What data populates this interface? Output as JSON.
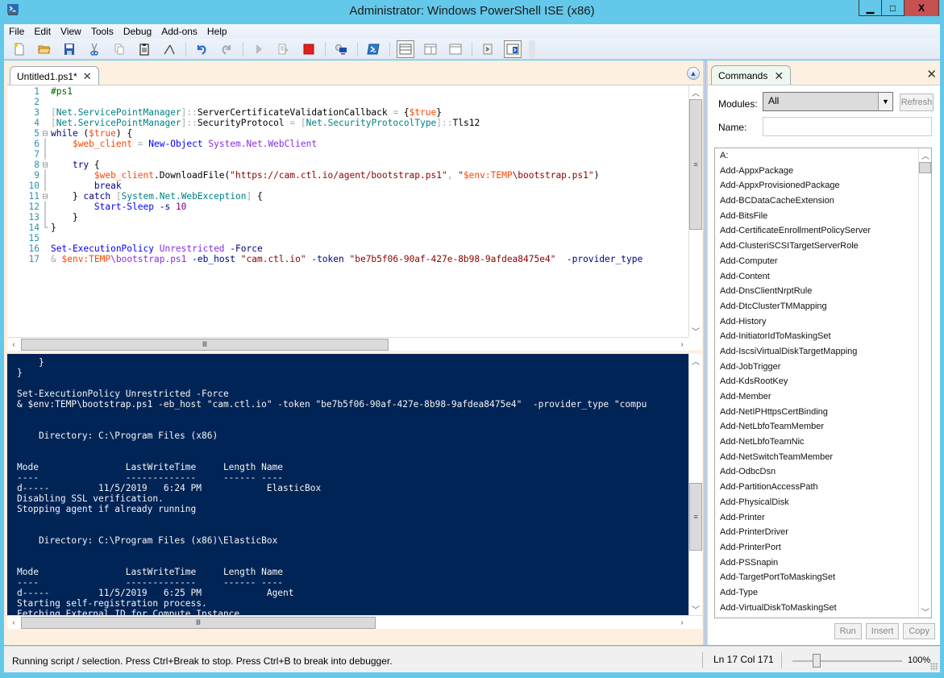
{
  "window": {
    "title": "Administrator: Windows PowerShell ISE (x86)",
    "controls": {
      "minimize": "▁",
      "maximize": "□",
      "close": "X"
    }
  },
  "menu": [
    "File",
    "Edit",
    "View",
    "Tools",
    "Debug",
    "Add-ons",
    "Help"
  ],
  "toolbar": {
    "buttons": [
      {
        "name": "new-icon",
        "tooltip": "New"
      },
      {
        "name": "open-icon",
        "tooltip": "Open"
      },
      {
        "name": "save-icon",
        "tooltip": "Save"
      },
      {
        "name": "cut-icon",
        "tooltip": "Cut"
      },
      {
        "name": "copy-icon",
        "tooltip": "Copy"
      },
      {
        "name": "paste-icon",
        "tooltip": "Paste"
      },
      {
        "name": "clear-console-icon",
        "tooltip": "Clear Console Pane"
      },
      {
        "name": "undo-icon",
        "tooltip": "Undo"
      },
      {
        "name": "redo-icon",
        "tooltip": "Redo"
      },
      {
        "name": "run-icon",
        "tooltip": "Run Script"
      },
      {
        "name": "run-selection-icon",
        "tooltip": "Run Selection"
      },
      {
        "name": "stop-icon",
        "tooltip": "Stop Operation"
      },
      {
        "name": "remote-tab-icon",
        "tooltip": "New Remote PowerShell Tab"
      },
      {
        "name": "powershell-console-icon",
        "tooltip": "Start PowerShell.exe"
      },
      {
        "name": "script-top-icon",
        "tooltip": "Show Script Pane Top"
      },
      {
        "name": "script-right-icon",
        "tooltip": "Show Script Pane Right"
      },
      {
        "name": "script-max-icon",
        "tooltip": "Show Script Pane Maximized"
      },
      {
        "name": "show-addon-icon",
        "tooltip": "Show Command Window"
      },
      {
        "name": "show-command-addon-icon",
        "tooltip": "Show Command Add-on"
      }
    ]
  },
  "script_tab": {
    "label": "Untitled1.ps1*",
    "close": "✕"
  },
  "editor": {
    "lines": [
      {
        "n": "1",
        "fold": "",
        "tokens": [
          [
            "c-comment",
            "#ps1"
          ]
        ]
      },
      {
        "n": "2",
        "fold": "",
        "tokens": []
      },
      {
        "n": "3",
        "fold": "",
        "tokens": [
          [
            "c-op",
            "["
          ],
          [
            "c-type",
            "Net.ServicePointManager"
          ],
          [
            "c-op",
            "]::"
          ],
          [
            "c-mem",
            "ServerCertificateValidationCallback"
          ],
          [
            "c-op",
            " = "
          ],
          [
            "c-mem",
            "{"
          ],
          [
            "c-var",
            "$true"
          ],
          [
            "c-mem",
            "}"
          ]
        ]
      },
      {
        "n": "4",
        "fold": "",
        "tokens": [
          [
            "c-op",
            "["
          ],
          [
            "c-type",
            "Net.ServicePointManager"
          ],
          [
            "c-op",
            "]::"
          ],
          [
            "c-mem",
            "SecurityProtocol"
          ],
          [
            "c-op",
            " = "
          ],
          [
            "c-op",
            "["
          ],
          [
            "c-type",
            "Net.SecurityProtocolType"
          ],
          [
            "c-op",
            "]::"
          ],
          [
            "c-mem",
            "Tls12"
          ]
        ]
      },
      {
        "n": "5",
        "fold": "⊟",
        "tokens": [
          [
            "c-kw",
            "while"
          ],
          [
            "c-mem",
            " ("
          ],
          [
            "c-var",
            "$true"
          ],
          [
            "c-mem",
            ") {"
          ]
        ]
      },
      {
        "n": "6",
        "fold": "│",
        "tokens": [
          [
            "c-mem",
            "    "
          ],
          [
            "c-var",
            "$web_client"
          ],
          [
            "c-op",
            " = "
          ],
          [
            "c-cmd",
            "New-Object"
          ],
          [
            "c-arg",
            " System.Net.WebClient"
          ]
        ]
      },
      {
        "n": "7",
        "fold": "│",
        "tokens": []
      },
      {
        "n": "8",
        "fold": "⊟",
        "tokens": [
          [
            "c-mem",
            "    "
          ],
          [
            "c-kw",
            "try"
          ],
          [
            "c-mem",
            " {"
          ]
        ]
      },
      {
        "n": "9",
        "fold": "│",
        "tokens": [
          [
            "c-mem",
            "        "
          ],
          [
            "c-var",
            "$web_client"
          ],
          [
            "c-mem",
            ".DownloadFile("
          ],
          [
            "c-str",
            "\"https://cam.ctl.io/agent/bootstrap.ps1\""
          ],
          [
            "c-op",
            ", "
          ],
          [
            "c-str",
            "\""
          ],
          [
            "c-var",
            "$env:TEMP"
          ],
          [
            "c-str",
            "\\bootstrap.ps1\""
          ],
          [
            "c-mem",
            ")"
          ]
        ]
      },
      {
        "n": "10",
        "fold": "│",
        "tokens": [
          [
            "c-mem",
            "        "
          ],
          [
            "c-kw",
            "break"
          ]
        ]
      },
      {
        "n": "11",
        "fold": "⊟",
        "tokens": [
          [
            "c-mem",
            "    } "
          ],
          [
            "c-kw",
            "catch"
          ],
          [
            "c-mem",
            " "
          ],
          [
            "c-op",
            "["
          ],
          [
            "c-type",
            "System.Net.WebException"
          ],
          [
            "c-op",
            "]"
          ],
          [
            "c-mem",
            " {"
          ]
        ]
      },
      {
        "n": "12",
        "fold": "│",
        "tokens": [
          [
            "c-mem",
            "        "
          ],
          [
            "c-cmd",
            "Start-Sleep"
          ],
          [
            "c-param",
            " -s"
          ],
          [
            "c-num",
            " 10"
          ]
        ]
      },
      {
        "n": "13",
        "fold": "│",
        "tokens": [
          [
            "c-mem",
            "    }"
          ]
        ]
      },
      {
        "n": "14",
        "fold": "└",
        "tokens": [
          [
            "c-mem",
            "}"
          ]
        ]
      },
      {
        "n": "15",
        "fold": "",
        "tokens": []
      },
      {
        "n": "16",
        "fold": "",
        "tokens": [
          [
            "c-cmd",
            "Set-ExecutionPolicy"
          ],
          [
            "c-arg",
            " Unrestricted"
          ],
          [
            "c-param",
            " -Force"
          ]
        ]
      },
      {
        "n": "17",
        "fold": "",
        "tokens": [
          [
            "c-op",
            "& "
          ],
          [
            "c-var",
            "$env:TEMP"
          ],
          [
            "c-arg",
            "\\bootstrap.ps1"
          ],
          [
            "c-param",
            " -eb_host"
          ],
          [
            "c-str",
            " \"cam.ctl.io\""
          ],
          [
            "c-param",
            " -token"
          ],
          [
            "c-str",
            " \"be7b5f06-90af-427e-8b98-9afdea8475e4\""
          ],
          [
            "c-param",
            "  -provider_type"
          ]
        ]
      }
    ]
  },
  "console": {
    "lines": [
      "    }",
      "}",
      "",
      "Set-ExecutionPolicy Unrestricted -Force",
      "& $env:TEMP\\bootstrap.ps1 -eb_host \"cam.ctl.io\" -token \"be7b5f06-90af-427e-8b98-9afdea8475e4\"  -provider_type \"compu",
      "",
      "",
      "    Directory: C:\\Program Files (x86)",
      "",
      "",
      "Mode                LastWriteTime     Length Name",
      "----                -------------     ------ ----",
      "d-----         11/5/2019   6:24 PM            ElasticBox",
      "Disabling SSL verification.",
      "Stopping agent if already running",
      "",
      "",
      "    Directory: C:\\Program Files (x86)\\ElasticBox",
      "",
      "",
      "Mode                LastWriteTime     Length Name",
      "----                -------------     ------ ----",
      "d-----         11/5/2019   6:25 PM            Agent",
      "Starting self-registration process.",
      "Fetching External ID for Compute Instance."
    ]
  },
  "commands": {
    "tab_label": "Commands",
    "tab_close": "✕",
    "pane_close": "✕",
    "modules_label": "Modules:",
    "modules_value": "All",
    "refresh_label": "Refresh",
    "name_label": "Name:",
    "name_value": "",
    "items": [
      "A:",
      "Add-AppxPackage",
      "Add-AppxProvisionedPackage",
      "Add-BCDataCacheExtension",
      "Add-BitsFile",
      "Add-CertificateEnrollmentPolicyServer",
      "Add-ClusteriSCSITargetServerRole",
      "Add-Computer",
      "Add-Content",
      "Add-DnsClientNrptRule",
      "Add-DtcClusterTMMapping",
      "Add-History",
      "Add-InitiatorIdToMaskingSet",
      "Add-IscsiVirtualDiskTargetMapping",
      "Add-JobTrigger",
      "Add-KdsRootKey",
      "Add-Member",
      "Add-NetIPHttpsCertBinding",
      "Add-NetLbfoTeamMember",
      "Add-NetLbfoTeamNic",
      "Add-NetSwitchTeamMember",
      "Add-OdbcDsn",
      "Add-PartitionAccessPath",
      "Add-PhysicalDisk",
      "Add-Printer",
      "Add-PrinterDriver",
      "Add-PrinterPort",
      "Add-PSSnapin",
      "Add-TargetPortToMaskingSet",
      "Add-Type",
      "Add-VirtualDiskToMaskingSet"
    ],
    "run_label": "Run",
    "insert_label": "Insert",
    "copy_label": "Copy"
  },
  "status": {
    "message": "Running script / selection.  Press Ctrl+Break to stop.  Press Ctrl+B to break into debugger.",
    "position": "Ln 17  Col 171",
    "zoom": "100%",
    "zoom_fraction": 0.22
  },
  "colors": {
    "titlebar": "#64c8ea",
    "console_bg": "#012456",
    "close_button": "#c75050",
    "stop_button": "#e02020"
  }
}
